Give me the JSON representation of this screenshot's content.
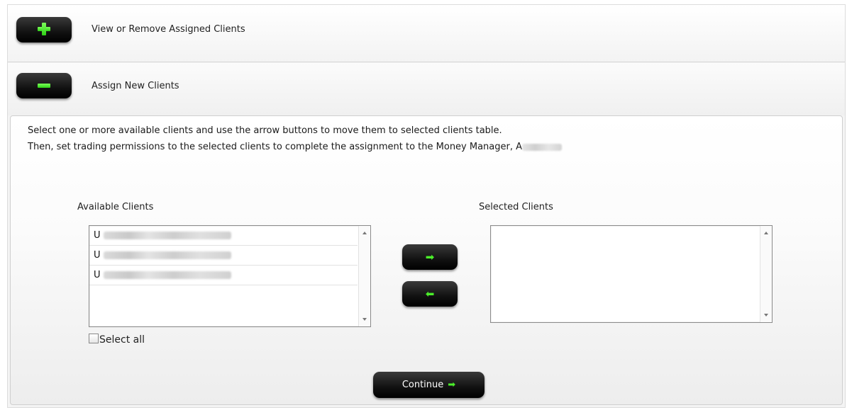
{
  "sections": {
    "view_remove_label": "View or Remove Assigned Clients",
    "assign_new_label": "Assign New Clients"
  },
  "instructions": {
    "line1": "Select one or more available clients and use the arrow buttons to move them to selected clients table.",
    "line2_prefix": "Then, set trading permissions to the selected clients to complete the assignment to the Money Manager, A"
  },
  "available": {
    "title": "Available Clients",
    "clients": [
      {
        "prefix": "U"
      },
      {
        "prefix": "U"
      },
      {
        "prefix": "U"
      }
    ]
  },
  "selected": {
    "title": "Selected Clients"
  },
  "buttons": {
    "move_right_icon": "arrow-right-icon",
    "move_left_icon": "arrow-left-icon",
    "continue_label": "Continue",
    "continue_arrow": "➡"
  },
  "select_all_label": "Select all",
  "colors": {
    "accent_green": "#4bee2a",
    "button_dark": "#111111"
  }
}
